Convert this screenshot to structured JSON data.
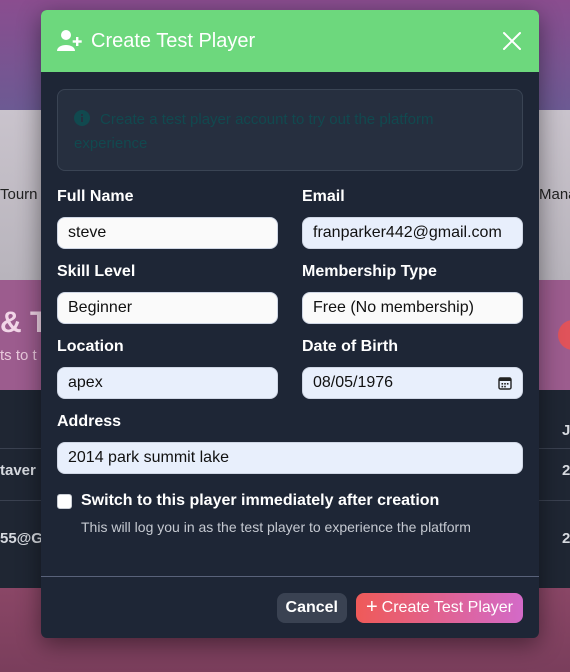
{
  "background": {
    "left_fragment_1": "Tourn",
    "right_fragment_1": "Mana",
    "left_fragment_2": "& T",
    "left_fragment_3": "ts to t",
    "left_fragment_4": "taver",
    "left_fragment_5": "55@G",
    "right_col_header": "J",
    "right_col_1": "2",
    "right_col_2": "2"
  },
  "modal": {
    "title": "Create Test Player",
    "info_text": "Create a test player account to try out the platform experience",
    "fields": {
      "full_name": {
        "label": "Full Name",
        "value": "steve"
      },
      "email": {
        "label": "Email",
        "value": "franparker442@gmail.com"
      },
      "skill_level": {
        "label": "Skill Level",
        "value": "Beginner"
      },
      "membership_type": {
        "label": "Membership Type",
        "value": "Free (No membership)"
      },
      "location": {
        "label": "Location",
        "value": "apex"
      },
      "date_of_birth": {
        "label": "Date of Birth",
        "value": "08/05/1976"
      },
      "address": {
        "label": "Address",
        "value": "2014 park summit lake"
      }
    },
    "switch_option": {
      "label": "Switch to this player immediately after creation",
      "help": "This will log you in as the test player to experience the platform",
      "checked": false
    },
    "buttons": {
      "cancel": "Cancel",
      "create": "Create Test Player"
    }
  },
  "colors": {
    "header": "#6dd87d",
    "modal_bg": "#1e2636",
    "create_start": "#ef5a58",
    "create_end": "#d36ac8"
  }
}
